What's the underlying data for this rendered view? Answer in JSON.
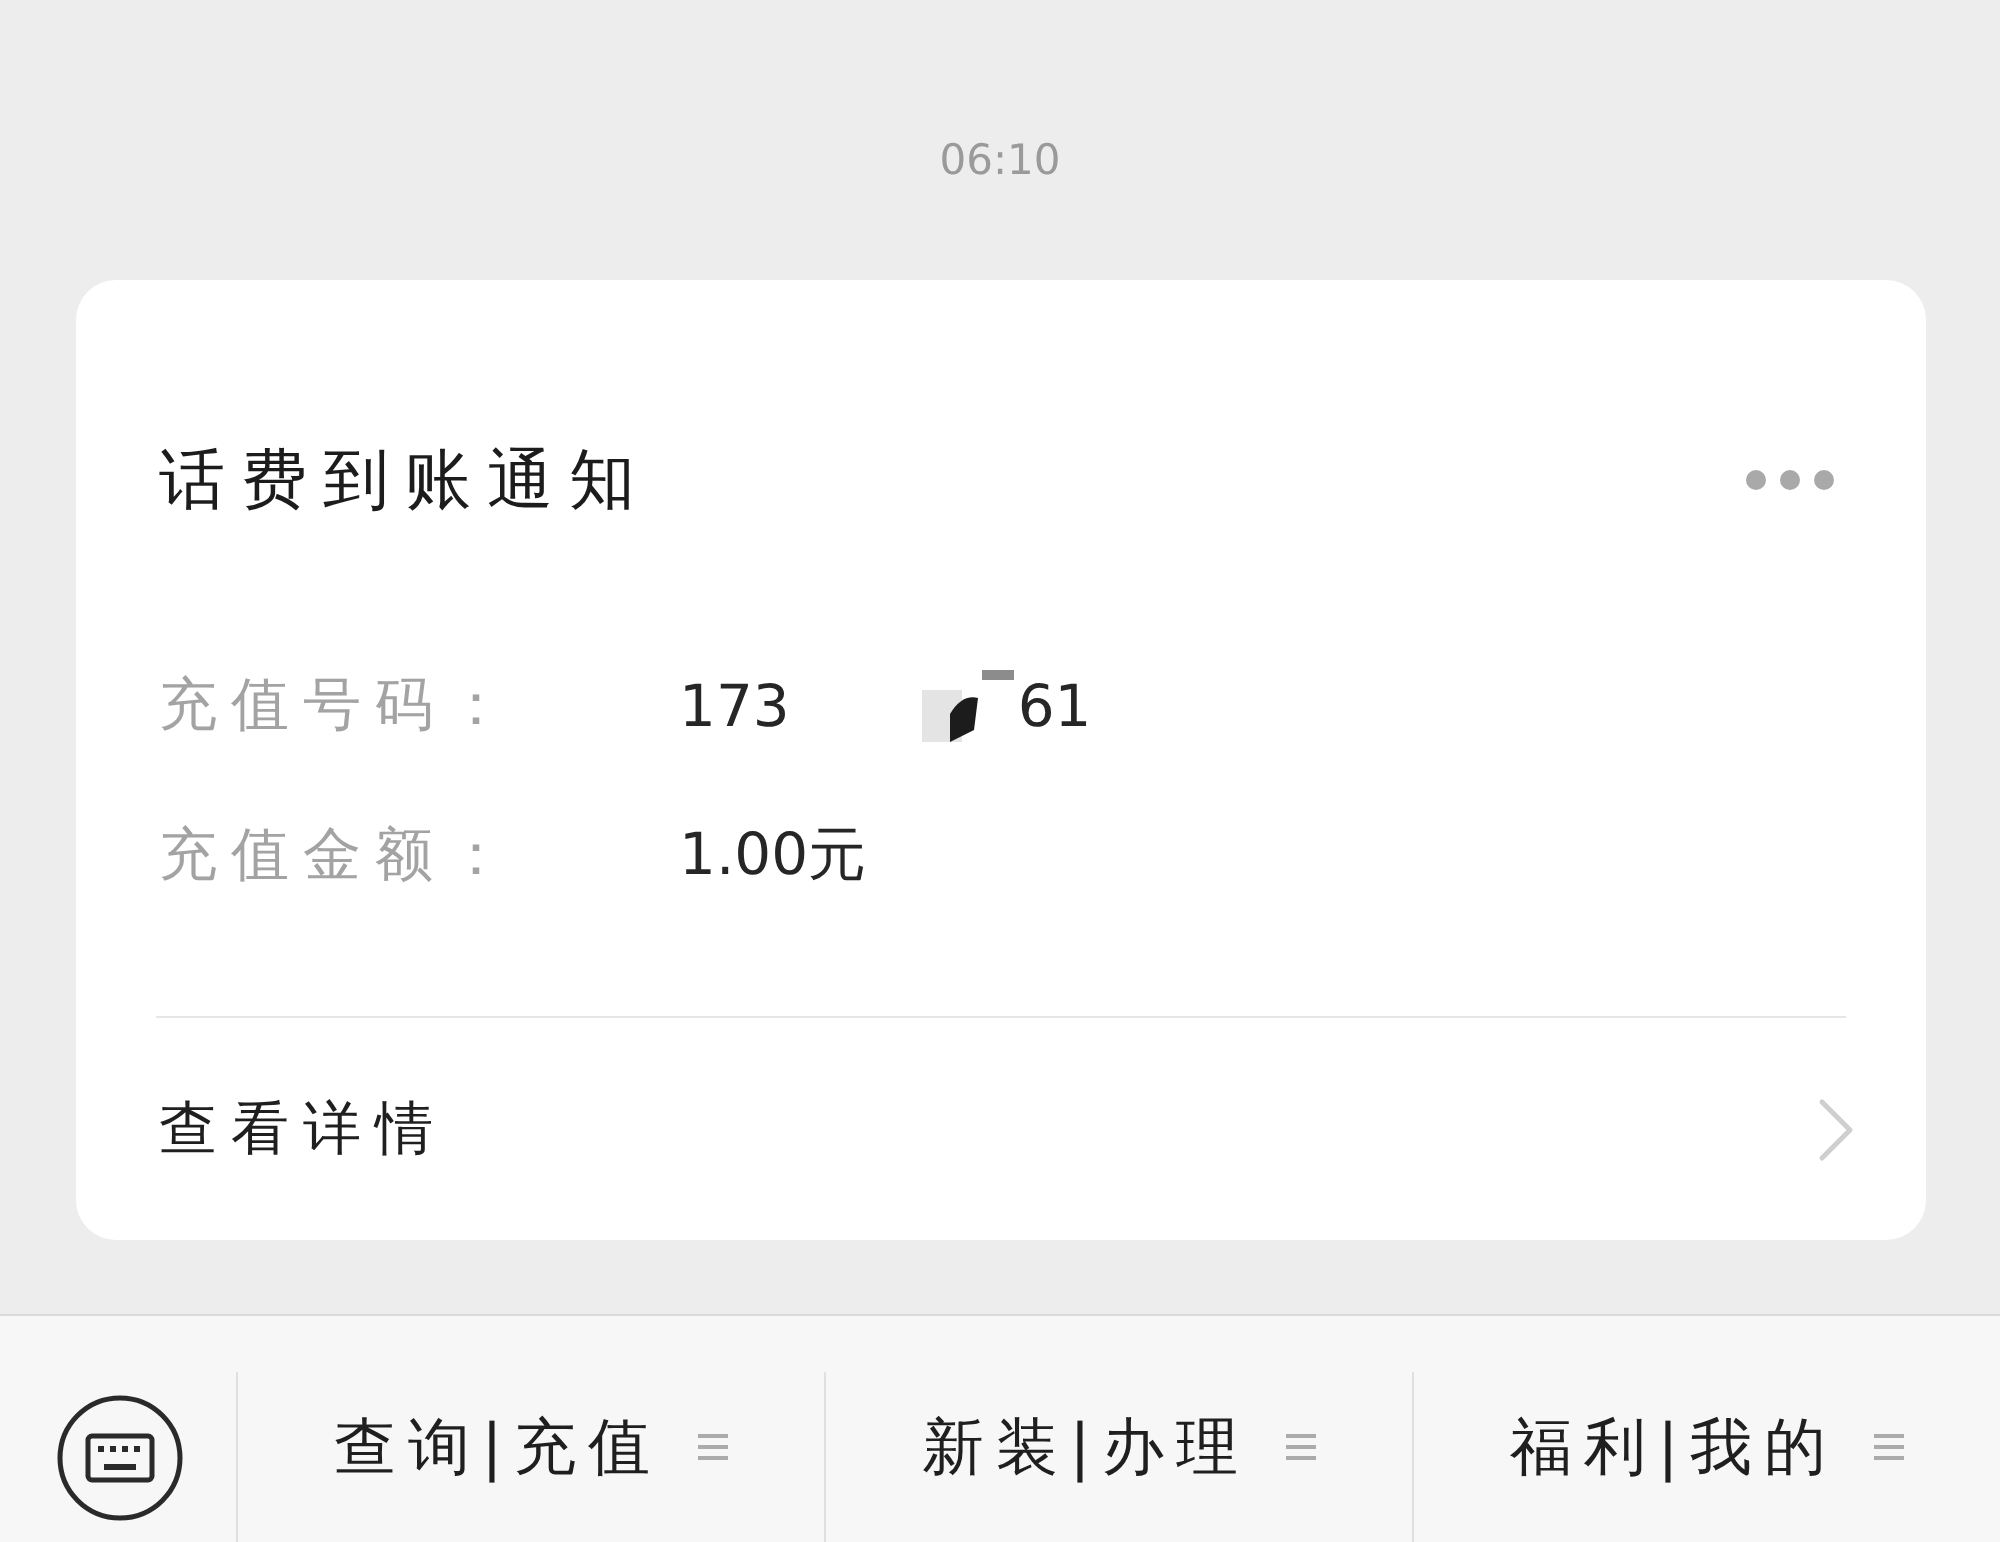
{
  "time": "06:10",
  "card": {
    "title": "话费到账通知",
    "fields": [
      {
        "label": "充值号码：",
        "value": "173",
        "redacted": true,
        "value_tail": "61"
      },
      {
        "label": "充值金额：",
        "value": "1.00元",
        "redacted": false
      }
    ],
    "link": "查看详情"
  },
  "menu_bar": {
    "items": [
      {
        "label": "查询|充值"
      },
      {
        "label": "新装|办理"
      },
      {
        "label": "福利|我的"
      }
    ]
  }
}
